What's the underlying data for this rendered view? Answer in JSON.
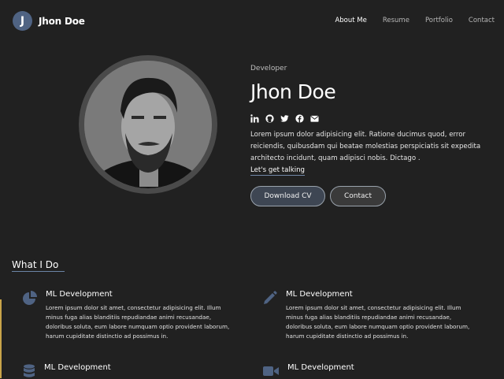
{
  "brand": {
    "initial": "J",
    "name": "Jhon Doe"
  },
  "nav": {
    "items": [
      "About Me",
      "Resume",
      "Portfolio",
      "Contact"
    ],
    "active": "About Me"
  },
  "hero": {
    "role": "Developer",
    "name": "Jhon Doe",
    "socials": [
      "linkedin-icon",
      "github-icon",
      "twitter-icon",
      "facebook-icon",
      "envelope-icon"
    ],
    "bio": "Lorem ipsum dolor adipisicing elit. Ratione ducimus quod, error reiciendis, quibusdam qui beatae molestias perspiciatis sit expedita architecto incidunt, quam adipisci nobis. Dictago .",
    "link": "Let's get talking",
    "download_label": "Download CV",
    "contact_label": "Contact"
  },
  "services": {
    "title": "What I Do",
    "items": [
      {
        "icon": "pie-chart-icon",
        "title": "ML Development",
        "desc": "Lorem ipsum dolor sit amet, consectetur adipisicing elit. Illum minus fuga alias blanditiis repudiandae animi recusandae, doloribus soluta, eum labore numquam optio provident laborum, harum cupiditate distinctio ad possimus in."
      },
      {
        "icon": "pencil-icon",
        "title": "ML Development",
        "desc": "Lorem ipsum dolor sit amet, consectetur adipisicing elit. Illum minus fuga alias blanditiis repudiandae animi recusandae, doloribus soluta, eum labore numquam optio provident laborum, harum cupiditate distinctio ad possimus in."
      },
      {
        "icon": "database-icon",
        "title": "ML Development"
      },
      {
        "icon": "video-camera-icon",
        "title": "ML Development"
      }
    ]
  },
  "colors": {
    "accent": "#4f6383",
    "background": "#212121",
    "icon": "#4f6383"
  }
}
